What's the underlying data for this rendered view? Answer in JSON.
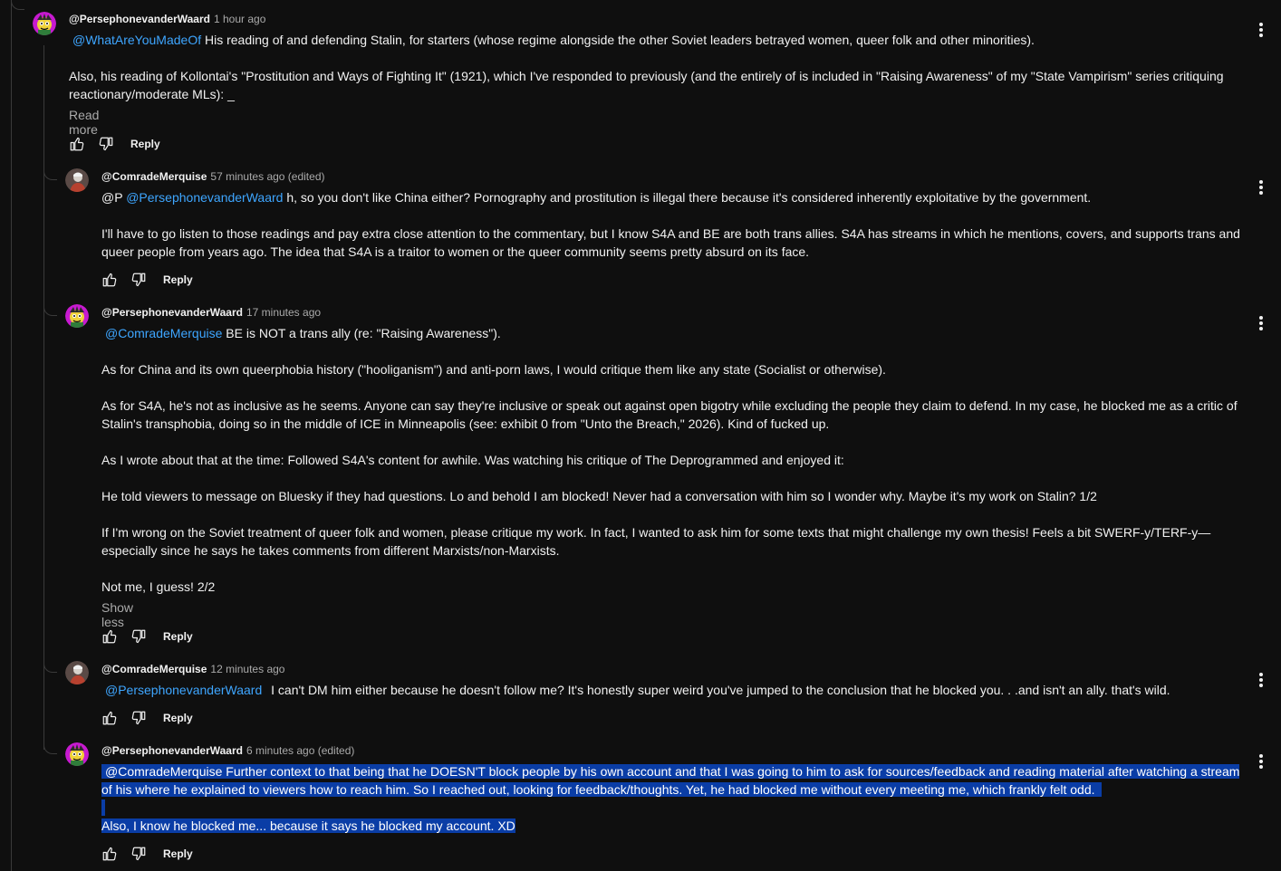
{
  "comments": [
    {
      "author": "@PersephonevanderWaard",
      "time": "1 hour ago",
      "mention": "@WhatAreYouMadeOf",
      "line1": "His reading of and defending Stalin, for starters (whose regime alongside the other Soviet leaders betrayed women, queer folk and other minorities).",
      "p2": "Also, his reading of Kollontai's \"Prostitution and Ways of Fighting It\" (1921), which I've responded to previously (and the entirely of is included in \"Raising Awareness\" of my \"State Vampirism\" series critiquing reactionary/moderate MLs): _",
      "more": "Read more",
      "reply": "Reply"
    },
    {
      "author": "@ComradeMerquise",
      "time": "57 minutes ago (edited)",
      "prefix": "@P",
      "mention": "@PersephonevanderWaard",
      "line1": "h, so you don't like China either? Pornography and prostitution is illegal there because it's considered inherently exploitative by the government.",
      "p2": "I'll have to go listen to those readings and pay extra close attention to the commentary, but I know S4A and BE are both trans allies. S4A has streams in which he mentions, covers, and supports trans and queer people from years ago. The idea that S4A is a traitor to women or the queer community seems pretty absurd on its face.",
      "reply": "Reply"
    },
    {
      "author": "@PersephonevanderWaard",
      "time": "17 minutes ago",
      "mention": "@ComradeMerquise",
      "line1": "BE is NOT a trans ally (re: \"Raising Awareness\").",
      "p2": "As for China and its own queerphobia history (\"hooliganism\") and anti-porn laws, I would critique them like any state (Socialist or otherwise).",
      "p3": "As for S4A, he's not as inclusive as he seems. Anyone can say they're inclusive or speak out against open bigotry while excluding the people they claim to defend. In my case, he blocked me as a critic of Stalin's transphobia, doing so in the middle of ICE in Minneapolis (see: exhibit 0 from \"Unto the Breach,\" 2026). Kind of fucked up.",
      "p4": "As I wrote about that at the time: Followed S4A's content for awhile. Was watching his critique of The Deprogrammed and enjoyed it:",
      "p5": "He told viewers to message on Bluesky if they had questions. Lo and behold I am blocked! Never had a conversation with him so I wonder why. Maybe it's my work on Stalin? 1/2",
      "p6": "If I'm wrong on the Soviet treatment of queer folk and women, please critique my work. In fact, I wanted to ask him for some texts that might challenge my own thesis! Feels a bit SWERF-y/TERF-y—especially since he says he takes comments from different Marxists/non-Marxists.",
      "p7": "Not me, I guess! 2/2",
      "less": "Show less",
      "reply": "Reply"
    },
    {
      "author": "@ComradeMerquise",
      "time": "12 minutes ago",
      "mention": "@PersephonevanderWaard",
      "line1": "I can't DM him either because he doesn't follow me? It's honestly super weird you've jumped to the conclusion that he blocked you. . .and isn't an ally. that's wild.",
      "reply": "Reply"
    },
    {
      "author": "@PersephonevanderWaard",
      "time": "6 minutes ago (edited)",
      "mention": "@ComradeMerquise",
      "line1": "Further context to that being that he DOESN'T block people by his own account and that I was going to him to ask for sources/feedback and reading material after watching a stream",
      "line2": "of his where he explained to viewers how to reach him. So I reached out, looking for feedback/thoughts. Yet, he had blocked me without every meeting me, which frankly felt odd.",
      "p3": "Also, I know he blocked me... because it says he blocked my account. XD",
      "reply": "Reply"
    }
  ],
  "colors": {
    "background": "#0f0f0f",
    "text": "#f1f1f1",
    "muted": "#aaaaaa",
    "mention": "#3ea6ff",
    "selection": "#0a3da6"
  }
}
